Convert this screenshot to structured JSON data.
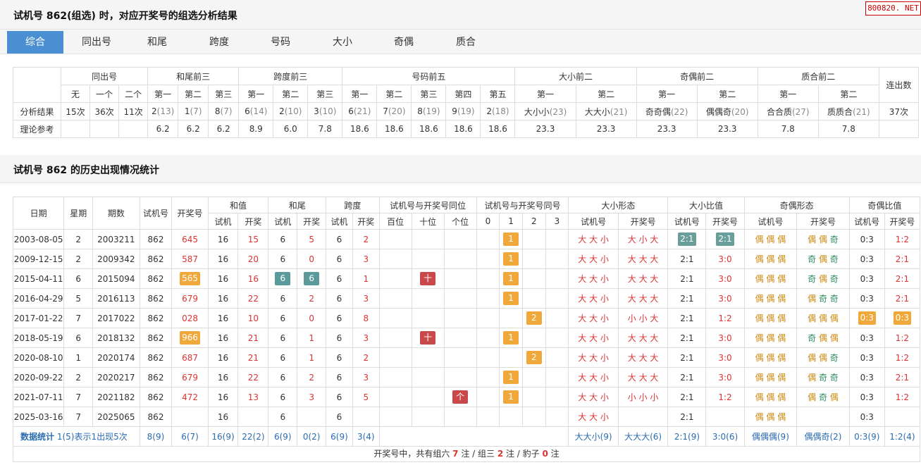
{
  "section1": {
    "title": "试机号 862(组选) 时，对应开奖号的组选分析结果",
    "badge": "800820. NET"
  },
  "tabs": [
    "综合",
    "同出号",
    "和尾",
    "跨度",
    "号码",
    "大小",
    "奇偶",
    "质合"
  ],
  "summary": {
    "group_headers": [
      "同出号",
      "和尾前三",
      "跨度前三",
      "号码前五",
      "大小前二",
      "奇偶前二",
      "质合前二",
      "连出数"
    ],
    "sub_headers": [
      "无",
      "一个",
      "二个",
      "第一",
      "第二",
      "第三",
      "第一",
      "第二",
      "第三",
      "第一",
      "第二",
      "第三",
      "第四",
      "第五",
      "第一",
      "第二",
      "第一",
      "第二",
      "第一",
      "第二"
    ],
    "row_labels": [
      "分析结果",
      "理论参考"
    ],
    "result": [
      {
        "v": "15次"
      },
      {
        "v": "36次"
      },
      {
        "v": "11次"
      },
      {
        "v": "2",
        "s": "(13)"
      },
      {
        "v": "1",
        "s": "(7)"
      },
      {
        "v": "8",
        "s": "(7)"
      },
      {
        "v": "6",
        "s": "(14)"
      },
      {
        "v": "2",
        "s": "(10)"
      },
      {
        "v": "3",
        "s": "(10)"
      },
      {
        "v": "6",
        "s": "(21)"
      },
      {
        "v": "7",
        "s": "(20)"
      },
      {
        "v": "8",
        "s": "(19)"
      },
      {
        "v": "9",
        "s": "(19)"
      },
      {
        "v": "2",
        "s": "(18)"
      },
      {
        "v": "大小小",
        "s": "(23)"
      },
      {
        "v": "大大小",
        "s": "(21)"
      },
      {
        "v": "奇奇偶",
        "s": "(22)"
      },
      {
        "v": "偶偶奇",
        "s": "(20)"
      },
      {
        "v": "合合质",
        "s": "(27)"
      },
      {
        "v": "质质合",
        "s": "(21)"
      },
      {
        "v": "37次"
      }
    ],
    "reference": [
      "",
      "",
      "",
      "6.2",
      "6.2",
      "6.2",
      "8.9",
      "6.0",
      "7.8",
      "18.6",
      "18.6",
      "18.6",
      "18.6",
      "18.6",
      "23.3",
      "23.3",
      "23.3",
      "23.3",
      "7.8",
      "7.8",
      ""
    ]
  },
  "section2": {
    "title": "试机号 862 的历史出现情况统计"
  },
  "history": {
    "top_headers": [
      "日期",
      "星期",
      "期数",
      "试机号",
      "开奖号",
      "和值",
      "和尾",
      "跨度",
      "试机号与开奖号同位",
      "试机号与开奖号同号",
      "大小形态",
      "大小比值",
      "奇偶形态",
      "奇偶比值"
    ],
    "sub_headers": [
      "试机",
      "开奖",
      "试机",
      "开奖",
      "试机",
      "开奖",
      "百位",
      "十位",
      "个位",
      "0",
      "1",
      "2",
      "3",
      "试机号",
      "开奖号",
      "试机号",
      "开奖号",
      "试机号",
      "开奖号",
      "试机号",
      "开奖号"
    ],
    "rows": [
      {
        "date": "2003-08-05",
        "week": "2",
        "issue": "2003211",
        "test": "862",
        "draw": "645",
        "drawBox": false,
        "sumT": "16",
        "sumD": "15",
        "tailT": "6",
        "tailD": "5",
        "tailBox": false,
        "spanT": "6",
        "spanD": "2",
        "pos": [
          "",
          "",
          ""
        ],
        "same": [
          "",
          "1",
          "",
          ""
        ],
        "bsT": "大 大 小",
        "bsD": "大 小 大",
        "brT": "2:1",
        "brD": "2:1",
        "brBox": true,
        "oeT": "偶 偶 偶",
        "oeD": "偶 偶 奇",
        "orT": "0:3",
        "orD": "1:2",
        "orBox": false
      },
      {
        "date": "2009-12-15",
        "week": "2",
        "issue": "2009342",
        "test": "862",
        "draw": "587",
        "drawBox": false,
        "sumT": "16",
        "sumD": "20",
        "tailT": "6",
        "tailD": "0",
        "tailBox": false,
        "spanT": "6",
        "spanD": "3",
        "pos": [
          "",
          "",
          ""
        ],
        "same": [
          "",
          "1",
          "",
          ""
        ],
        "bsT": "大 大 小",
        "bsD": "大 大 大",
        "brT": "2:1",
        "brD": "3:0",
        "brBox": false,
        "oeT": "偶 偶 偶",
        "oeD": "奇 偶 奇",
        "orT": "0:3",
        "orD": "2:1",
        "orBox": false
      },
      {
        "date": "2015-04-11",
        "week": "6",
        "issue": "2015094",
        "test": "862",
        "draw": "565",
        "drawBox": true,
        "sumT": "16",
        "sumD": "16",
        "tailT": "6",
        "tailD": "6",
        "tailBox": true,
        "spanT": "6",
        "spanD": "1",
        "pos": [
          "",
          "十",
          ""
        ],
        "same": [
          "",
          "1",
          "",
          ""
        ],
        "bsT": "大 大 小",
        "bsD": "大 大 大",
        "brT": "2:1",
        "brD": "3:0",
        "brBox": false,
        "oeT": "偶 偶 偶",
        "oeD": "奇 偶 奇",
        "orT": "0:3",
        "orD": "2:1",
        "orBox": false
      },
      {
        "date": "2016-04-29",
        "week": "5",
        "issue": "2016113",
        "test": "862",
        "draw": "679",
        "drawBox": false,
        "sumT": "16",
        "sumD": "22",
        "tailT": "6",
        "tailD": "2",
        "tailBox": false,
        "spanT": "6",
        "spanD": "3",
        "pos": [
          "",
          "",
          ""
        ],
        "same": [
          "",
          "1",
          "",
          ""
        ],
        "bsT": "大 大 小",
        "bsD": "大 大 大",
        "brT": "2:1",
        "brD": "3:0",
        "brBox": false,
        "oeT": "偶 偶 偶",
        "oeD": "偶 奇 奇",
        "orT": "0:3",
        "orD": "2:1",
        "orBox": false
      },
      {
        "date": "2017-01-22",
        "week": "7",
        "issue": "2017022",
        "test": "862",
        "draw": "028",
        "drawBox": false,
        "sumT": "16",
        "sumD": "10",
        "tailT": "6",
        "tailD": "0",
        "tailBox": false,
        "spanT": "6",
        "spanD": "8",
        "pos": [
          "",
          "",
          ""
        ],
        "same": [
          "",
          "",
          "2",
          ""
        ],
        "bsT": "大 大 小",
        "bsD": "小 小 大",
        "brT": "2:1",
        "brD": "1:2",
        "brBox": false,
        "oeT": "偶 偶 偶",
        "oeD": "偶 偶 偶",
        "orT": "0:3",
        "orD": "0:3",
        "orBox": true
      },
      {
        "date": "2018-05-19",
        "week": "6",
        "issue": "2018132",
        "test": "862",
        "draw": "966",
        "drawBox": true,
        "sumT": "16",
        "sumD": "21",
        "tailT": "6",
        "tailD": "1",
        "tailBox": false,
        "spanT": "6",
        "spanD": "3",
        "pos": [
          "",
          "十",
          ""
        ],
        "same": [
          "",
          "1",
          "",
          ""
        ],
        "bsT": "大 大 小",
        "bsD": "大 大 大",
        "brT": "2:1",
        "brD": "3:0",
        "brBox": false,
        "oeT": "偶 偶 偶",
        "oeD": "奇 偶 偶",
        "orT": "0:3",
        "orD": "1:2",
        "orBox": false
      },
      {
        "date": "2020-08-10",
        "week": "1",
        "issue": "2020174",
        "test": "862",
        "draw": "687",
        "drawBox": false,
        "sumT": "16",
        "sumD": "21",
        "tailT": "6",
        "tailD": "1",
        "tailBox": false,
        "spanT": "6",
        "spanD": "2",
        "pos": [
          "",
          "",
          ""
        ],
        "same": [
          "",
          "",
          "2",
          ""
        ],
        "bsT": "大 大 小",
        "bsD": "大 大 大",
        "brT": "2:1",
        "brD": "3:0",
        "brBox": false,
        "oeT": "偶 偶 偶",
        "oeD": "偶 偶 奇",
        "orT": "0:3",
        "orD": "1:2",
        "orBox": false
      },
      {
        "date": "2020-09-22",
        "week": "2",
        "issue": "2020217",
        "test": "862",
        "draw": "679",
        "drawBox": false,
        "sumT": "16",
        "sumD": "22",
        "tailT": "6",
        "tailD": "2",
        "tailBox": false,
        "spanT": "6",
        "spanD": "3",
        "pos": [
          "",
          "",
          ""
        ],
        "same": [
          "",
          "1",
          "",
          ""
        ],
        "bsT": "大 大 小",
        "bsD": "大 大 大",
        "brT": "2:1",
        "brD": "3:0",
        "brBox": false,
        "oeT": "偶 偶 偶",
        "oeD": "偶 奇 奇",
        "orT": "0:3",
        "orD": "2:1",
        "orBox": false
      },
      {
        "date": "2021-07-11",
        "week": "7",
        "issue": "2021182",
        "test": "862",
        "draw": "472",
        "drawBox": false,
        "sumT": "16",
        "sumD": "13",
        "tailT": "6",
        "tailD": "3",
        "tailBox": false,
        "spanT": "6",
        "spanD": "5",
        "pos": [
          "",
          "",
          "个"
        ],
        "same": [
          "",
          "1",
          "",
          ""
        ],
        "bsT": "大 大 小",
        "bsD": "小 小 小",
        "brT": "2:1",
        "brD": "1:2",
        "brBox": false,
        "oeT": "偶 偶 偶",
        "oeD": "偶 奇 偶",
        "orT": "0:3",
        "orD": "1:2",
        "orBox": false
      },
      {
        "date": "2025-03-16",
        "week": "7",
        "issue": "2025065",
        "test": "862",
        "draw": "",
        "drawBox": false,
        "sumT": "16",
        "sumD": "",
        "tailT": "6",
        "tailD": "",
        "tailBox": false,
        "spanT": "6",
        "spanD": "",
        "pos": [
          "",
          "",
          ""
        ],
        "same": [
          "",
          "",
          "",
          ""
        ],
        "bsT": "大 大 小",
        "bsD": "",
        "brT": "2:1",
        "brD": "",
        "brBox": false,
        "oeT": "偶 偶 偶",
        "oeD": "",
        "orT": "0:3",
        "orD": "",
        "orBox": false
      }
    ],
    "stats": {
      "label": "数据统计",
      "note": "1(5)表示1出现5次",
      "cells": [
        "8(9)",
        "6(7)",
        "16(9)",
        "22(2)",
        "6(9)",
        "0(2)",
        "6(9)",
        "3(4)",
        "大大小(9)",
        "大大大(6)",
        "2:1(9)",
        "3:0(6)",
        "偶偶偶(9)",
        "偶偶奇(2)",
        "0:3(9)",
        "1:2(4)"
      ]
    },
    "footer": {
      "prefix": "开奖号中，共有组六",
      "n6": "7",
      "u1": "注 / 组三",
      "n3": "2",
      "u2": "注 / 豹子",
      "nb": "0",
      "u3": "注"
    }
  }
}
